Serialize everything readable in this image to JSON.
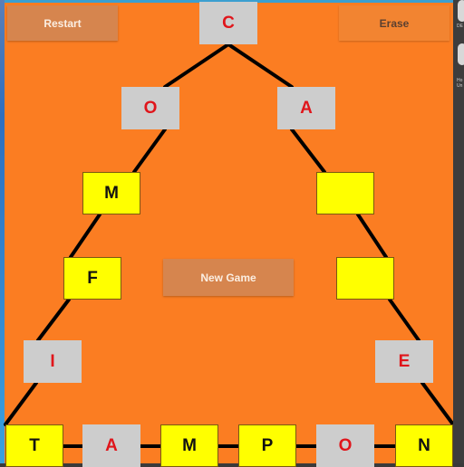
{
  "buttons": {
    "restart": "Restart",
    "erase": "Erase",
    "new_game": "New Game"
  },
  "colors": {
    "background": "#fb7d22",
    "tile_gray": "#cdcdcd",
    "tile_yellow": "#ffff00",
    "letter_red": "#e0151b",
    "letter_black": "#111111",
    "connector": "#000000"
  },
  "pyramid": {
    "apex": {
      "letter": "C",
      "style": "gray"
    },
    "left_side": [
      {
        "letter": "O",
        "style": "gray"
      },
      {
        "letter": "M",
        "style": "yellow"
      },
      {
        "letter": "F",
        "style": "yellow"
      },
      {
        "letter": "I",
        "style": "gray"
      }
    ],
    "right_side": [
      {
        "letter": "A",
        "style": "gray"
      },
      {
        "letter": "",
        "style": "yellow"
      },
      {
        "letter": "",
        "style": "yellow"
      },
      {
        "letter": "E",
        "style": "gray"
      }
    ],
    "base_row": [
      {
        "letter": "T",
        "style": "yellow"
      },
      {
        "letter": "A",
        "style": "gray"
      },
      {
        "letter": "M",
        "style": "yellow"
      },
      {
        "letter": "P",
        "style": "yellow"
      },
      {
        "letter": "O",
        "style": "gray"
      },
      {
        "letter": "N",
        "style": "yellow"
      }
    ]
  },
  "side_panel": {
    "label_1": "DE",
    "label_2": "Ho Un"
  }
}
